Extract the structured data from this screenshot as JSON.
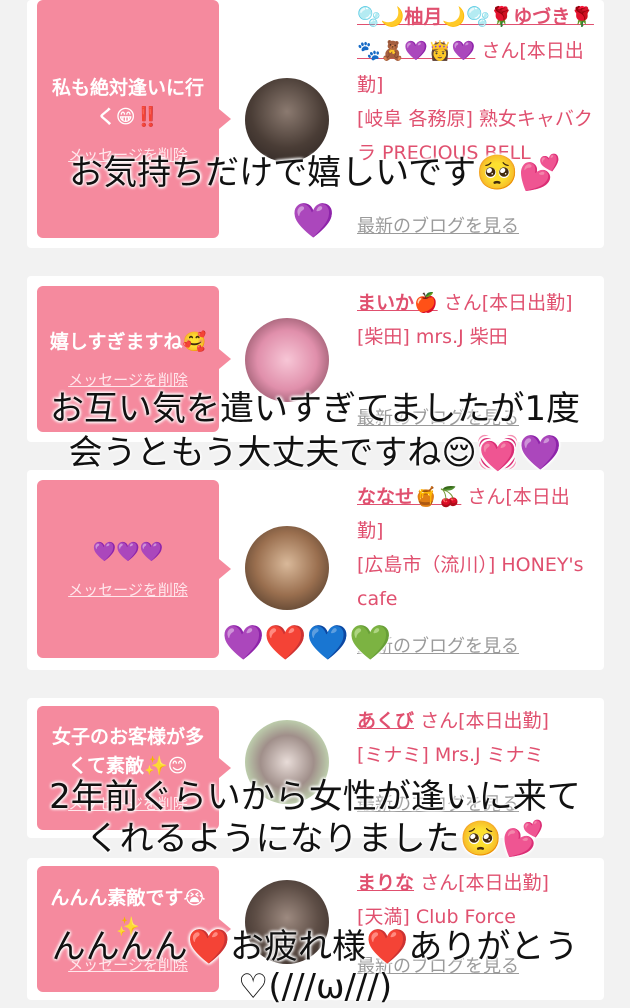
{
  "cards": [
    {
      "message": "私も絶対逢いに行く😁‼️",
      "delete_label": "メッセージを削除",
      "name": "🫧🌙柚月🌙🫧🌹ゆづき🌹🐾🧸💜👸💜",
      "title_suffix": "さん[本日出勤]",
      "location": "[岐阜 各務原] 熟女キャバクラ PRECIOUS BELL",
      "blog_label": "最新のブログを見る"
    },
    {
      "message": "嬉しすぎますね🥰",
      "delete_label": "メッセージを削除",
      "name": "まいか🍎",
      "title_suffix": "さん[本日出勤]",
      "location": "[柴田] mrs.J 柴田",
      "blog_label": "最新のブログを見る"
    },
    {
      "message": "💜💜💜",
      "delete_label": "メッセージを削除",
      "name": "ななせ🍯🍒",
      "title_suffix": "さん[本日出勤]",
      "location": "[広島市（流川）] HONEY's cafe",
      "blog_label": "最新のブログを見る"
    },
    {
      "message": "女子のお客様が多くて素敵✨😊",
      "delete_label": "メッセージを削除",
      "name": "あくび",
      "title_suffix": "さん[本日出勤]",
      "location": "[ミナミ] Mrs.J ミナミ",
      "blog_label": "最新のブログを見る"
    },
    {
      "message": "んんん素敵です😭✨",
      "delete_label": "メッセージを削除",
      "name": "まりな",
      "title_suffix": "さん[本日出勤]",
      "location": "[天満] Club Force",
      "blog_label": "最新のブログを見る"
    }
  ],
  "overlays": [
    {
      "text": "お気持ちだけで嬉しいです🥺💕"
    },
    {
      "text": "💜"
    },
    {
      "text": "お互い気を遣いすぎてましたが1度"
    },
    {
      "text": "会うともう大丈夫ですね😌💓💜"
    },
    {
      "text": "💜❤️💙💚"
    },
    {
      "text": "2年前ぐらいから女性が逢いに来て"
    },
    {
      "text": "くれるようになりました🥺💕"
    },
    {
      "text": "んんんん❤️お疲れ様❤️ありがとう"
    },
    {
      "text": "♡(///ω///)"
    }
  ],
  "colors": {
    "accent": "#e0506f",
    "bubble": "#f58a9e",
    "background": "#f2f2f2"
  }
}
